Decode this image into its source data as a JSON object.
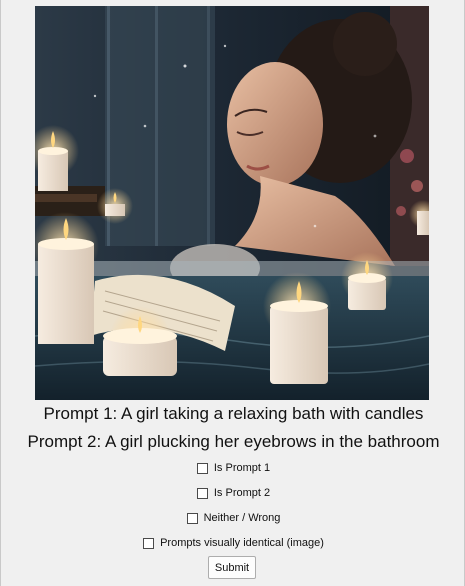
{
  "image": {
    "subject": "candlelit-bath-illustration"
  },
  "prompts": {
    "prompt1": "Prompt 1: A girl taking a relaxing bath with candles",
    "prompt2": "Prompt 2: A girl plucking her eyebrows in the bathroom"
  },
  "options": [
    {
      "label": "Is Prompt 1",
      "checked": false
    },
    {
      "label": "Is Prompt 2",
      "checked": false
    },
    {
      "label": "Neither / Wrong",
      "checked": false
    },
    {
      "label": "Prompts visually identical (image)",
      "checked": false
    }
  ],
  "submit_label": "Submit",
  "colors": {
    "window_bg": "#f0f0f0",
    "text": "#111111"
  }
}
